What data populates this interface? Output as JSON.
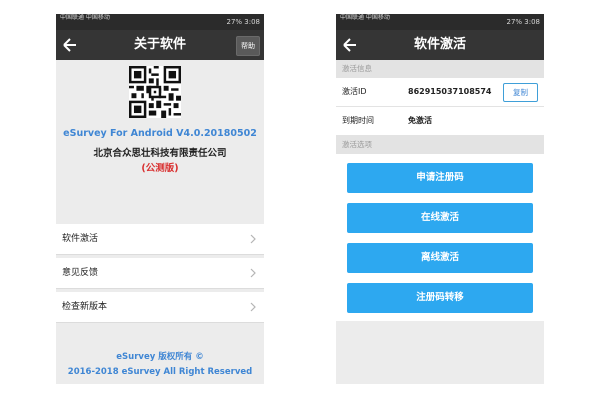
{
  "left_screen": {
    "status_bar": {
      "left_text": "中国联通 中国移动",
      "right_text": "27% 3:08"
    },
    "title": "关于软件",
    "help_label": "帮助",
    "version": "eSurvey For Android V4.0.20180502",
    "company": "北京合众思壮科技有限责任公司",
    "edition": "(公测版)",
    "menu_items": [
      {
        "label": "软件激活"
      },
      {
        "label": "意见反馈"
      },
      {
        "label": "检查新版本"
      }
    ],
    "footer": {
      "line1": "eSurvey 版权所有 ©",
      "line2": "2016-2018 eSurvey All Right Reserved"
    }
  },
  "right_screen": {
    "status_bar": {
      "left_text": "中国联通 中国移动",
      "right_text": "27% 3:08"
    },
    "title": "软件激活",
    "info_section_label": "激活信息",
    "activation_id_label": "激活ID",
    "activation_id_value": "862915037108574",
    "copy_label": "复制",
    "expiry_label": "到期时间",
    "expiry_value": "免激活",
    "options_section_label": "激活选项",
    "buttons": [
      {
        "label": "申请注册码"
      },
      {
        "label": "在线激活"
      },
      {
        "label": "离线激活"
      },
      {
        "label": "注册码转移"
      }
    ]
  },
  "colors": {
    "accent_blue": "#2da8f0",
    "link_blue": "#3f86d4",
    "title_bar": "#353535",
    "edition_red": "#d93030"
  }
}
